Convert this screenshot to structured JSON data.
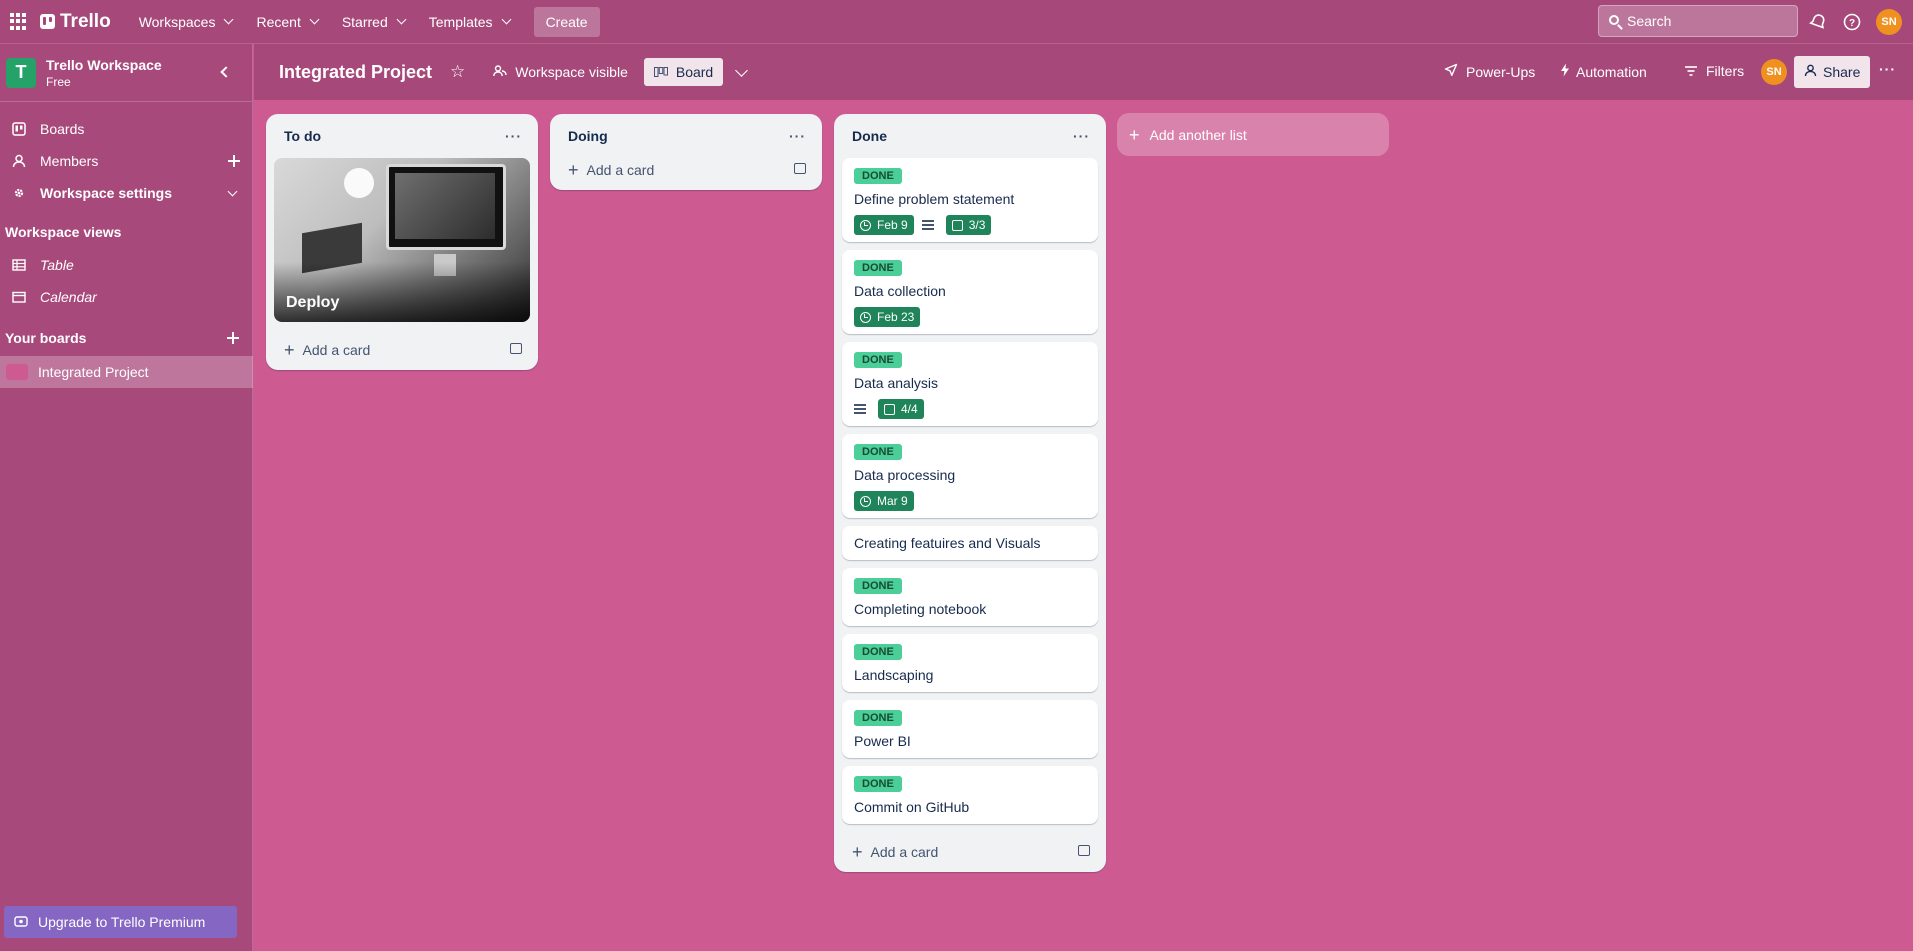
{
  "topnav": {
    "logo": "Trello",
    "menus": [
      "Workspaces",
      "Recent",
      "Starred",
      "Templates"
    ],
    "create": "Create",
    "search_placeholder": "Search",
    "avatar": "SN"
  },
  "sidebar": {
    "workspace_logo": "T",
    "workspace_name": "Trello Workspace",
    "workspace_plan": "Free",
    "items": [
      {
        "label": "Boards",
        "icon": "trello-board-icon"
      },
      {
        "label": "Members",
        "icon": "person-icon"
      },
      {
        "label": "Workspace settings",
        "icon": "gear-icon"
      }
    ],
    "views_heading": "Workspace views",
    "views": [
      {
        "label": "Table",
        "icon": "table-icon"
      },
      {
        "label": "Calendar",
        "icon": "calendar-icon"
      }
    ],
    "your_boards_heading": "Your boards",
    "boards": [
      {
        "label": "Integrated Project",
        "color": "#cd5a91"
      }
    ],
    "upgrade": "Upgrade to Trello Premium"
  },
  "board": {
    "title": "Integrated Project",
    "visibility": "Workspace visible",
    "view": "Board",
    "powerups": "Power-Ups",
    "automation": "Automation",
    "filters": "Filters",
    "avatar": "SN",
    "share": "Share",
    "background_color": "#cd5a91"
  },
  "lists": [
    {
      "title": "To do",
      "cover_card": {
        "title": "Deploy"
      },
      "add_card": "Add a card"
    },
    {
      "title": "Doing",
      "add_card": "Add a card"
    },
    {
      "title": "Done",
      "add_card": "Add a card",
      "cards": [
        {
          "label": "DONE",
          "title": "Define problem statement",
          "due": "Feb 9",
          "has_description": true,
          "checklist": "3/3"
        },
        {
          "label": "DONE",
          "title": "Data collection",
          "due": "Feb 23"
        },
        {
          "label": "DONE",
          "title": "Data analysis",
          "has_description": true,
          "checklist": "4/4"
        },
        {
          "label": "DONE",
          "title": "Data processing",
          "due": "Mar 9"
        },
        {
          "title": "Creating featuires and Visuals"
        },
        {
          "label": "DONE",
          "title": "Completing notebook"
        },
        {
          "label": "DONE",
          "title": "Landscaping"
        },
        {
          "label": "DONE",
          "title": "Power BI"
        },
        {
          "label": "DONE",
          "title": "Commit on GitHub"
        }
      ]
    }
  ],
  "add_list": "Add another list"
}
